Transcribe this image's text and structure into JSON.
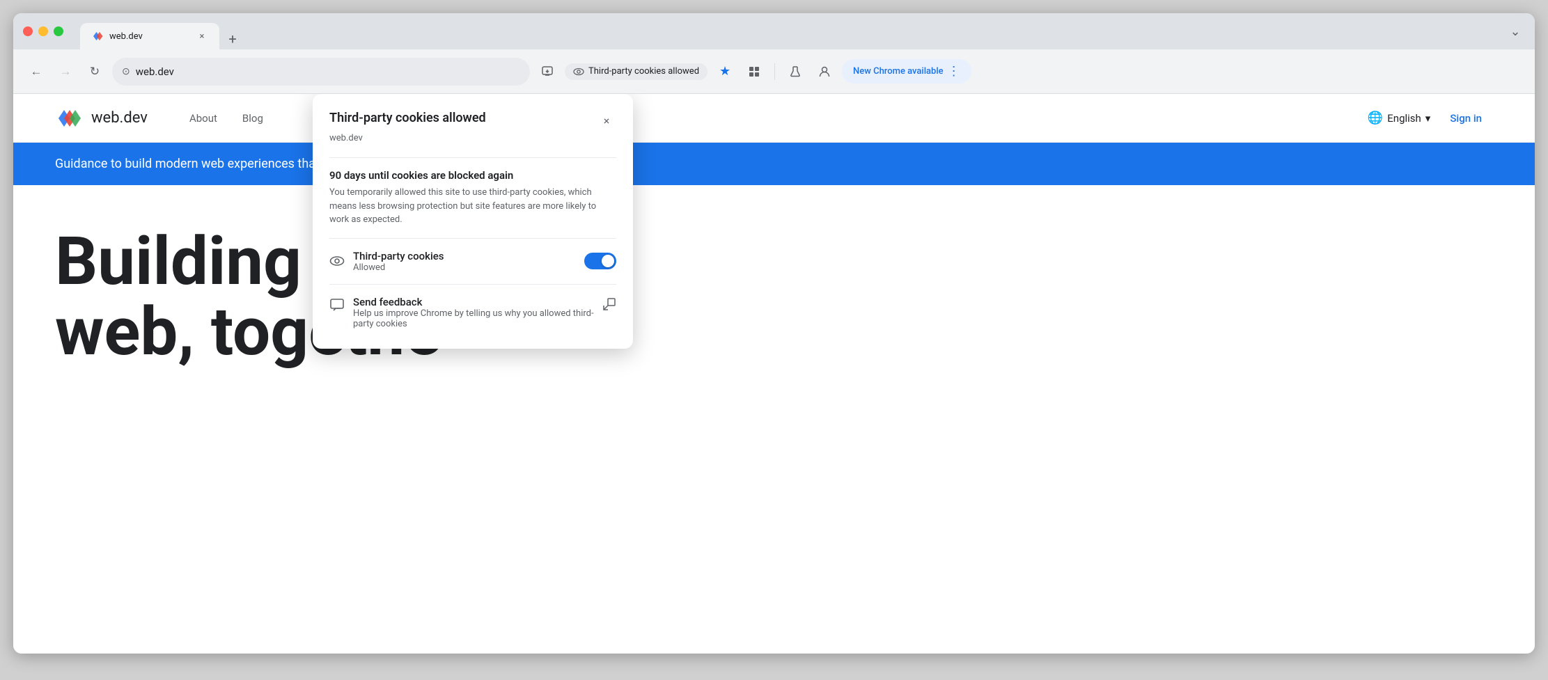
{
  "browser": {
    "tab": {
      "favicon_label": "web.dev favicon",
      "title": "web.dev",
      "close_label": "×"
    },
    "new_tab_label": "+",
    "menu_label": "⌄",
    "address": {
      "icon": "⊙",
      "url": "web.dev",
      "download_icon": "⬇",
      "cookies_label": "Third-party cookies allowed",
      "star_label": "★",
      "extensions_icon": "🧩",
      "lab_icon": "⚗",
      "profile_icon": "👤",
      "new_chrome_label": "New Chrome available",
      "more_icon": "⋮"
    },
    "nav": {
      "back_label": "←",
      "forward_label": "→",
      "refresh_label": "↻"
    }
  },
  "website": {
    "logo_alt": "web.dev logo",
    "site_name": "web.dev",
    "nav": [
      {
        "label": "About"
      },
      {
        "label": "Blog"
      }
    ],
    "language": {
      "icon": "🌐",
      "label": "English",
      "chevron": "▾"
    },
    "sign_in_label": "Sign in",
    "banner_text": "Guidance to build modern web experiences that work",
    "hero_title_line1": "Building a bet",
    "hero_title_line2": "web, togethe"
  },
  "cookie_popup": {
    "title": "Third-party cookies allowed",
    "subtitle": "web.dev",
    "close_label": "×",
    "warning": {
      "title": "90 days until cookies are blocked again",
      "text": "You temporarily allowed this site to use third-party cookies, which means less browsing protection but site features are more likely to work as expected."
    },
    "cookies_row": {
      "icon": "👁",
      "label": "Third-party cookies",
      "sublabel": "Allowed",
      "toggle_on": true
    },
    "feedback_row": {
      "icon": "💬",
      "label": "Send feedback",
      "sublabel": "Help us improve Chrome by telling us why you allowed third-party cookies",
      "external_icon": "↗"
    }
  }
}
